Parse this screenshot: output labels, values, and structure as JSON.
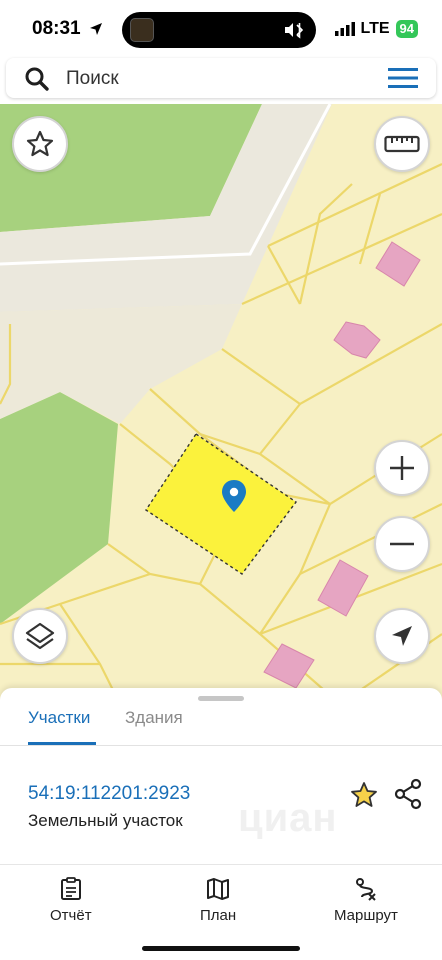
{
  "status_bar": {
    "time": "08:31",
    "network": "LTE",
    "battery": "94"
  },
  "search": {
    "placeholder": "Поиск"
  },
  "map": {
    "colors": {
      "base": "#f7f0c4",
      "parcel_line": "#ecd76a",
      "green_area": "#a7d17e",
      "road": "#ebe8dd",
      "building": "#e6a5c2",
      "selected_parcel": "#fbf23c",
      "marker": "#1a7bc4"
    },
    "buttons": [
      "star-icon",
      "ruler-icon",
      "plus-icon",
      "minus-icon",
      "layers-icon",
      "location-arrow-icon"
    ]
  },
  "sheet": {
    "tabs": [
      {
        "label": "Участки",
        "active": true
      },
      {
        "label": "Здания",
        "active": false
      }
    ],
    "parcel": {
      "cadastral_number": "54:19:112201:2923",
      "type": "Земельный участок"
    },
    "watermark": "циан"
  },
  "bottom_nav": {
    "items": [
      {
        "label": "Отчёт",
        "icon": "report-icon"
      },
      {
        "label": "План",
        "icon": "map-icon"
      },
      {
        "label": "Маршрут",
        "icon": "route-icon"
      }
    ]
  }
}
